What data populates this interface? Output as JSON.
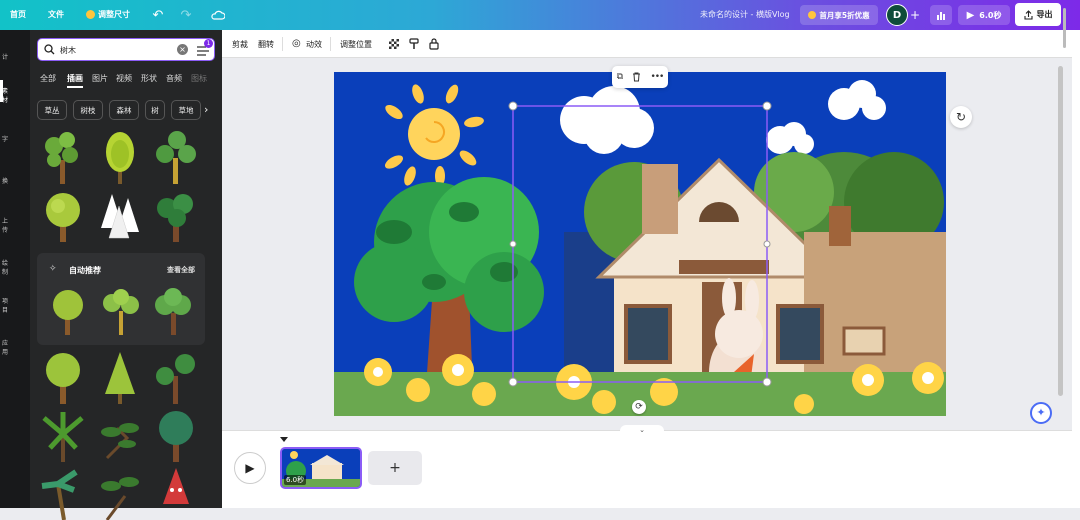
{
  "topbar": {
    "home": "首页",
    "file": "文件",
    "resize": "调整尺寸",
    "title": "未命名的设计 - 横版Vlog",
    "promo": "首月享5折优惠",
    "avatar": "D",
    "play_duration": "6.0秒",
    "export": "导出"
  },
  "rail": {
    "items": [
      "计",
      "素材",
      "字",
      "换",
      "上传",
      "绘制",
      "项目",
      "应用"
    ]
  },
  "panel": {
    "search_value": "树木",
    "filter_badge": "1",
    "tabs": [
      "全部",
      "插画",
      "图片",
      "视频",
      "形状",
      "音频",
      "图标"
    ],
    "chips": [
      "草丛",
      "树枝",
      "森林",
      "树",
      "草地"
    ],
    "auto_title": "自动推荐",
    "see_all": "查看全部"
  },
  "context_toolbar": {
    "crop": "剪裁",
    "flip": "翻转",
    "animate": "动效",
    "position": "调整位置"
  },
  "timeline": {
    "clip_duration": "6.0秒"
  },
  "colors": {
    "accent": "#8b3dff",
    "selection": "#8b5cf6",
    "sky": "#0a3fba"
  }
}
